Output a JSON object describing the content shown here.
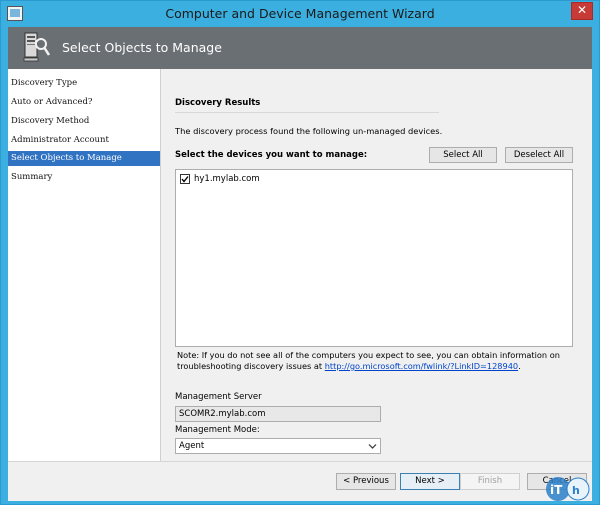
{
  "window": {
    "title": "Computer and Device Management Wizard",
    "close_label": "✕"
  },
  "header": {
    "title": "Select Objects to Manage"
  },
  "nav": {
    "items": [
      {
        "label": "Discovery Type"
      },
      {
        "label": "Auto or Advanced?"
      },
      {
        "label": "Discovery Method"
      },
      {
        "label": "Administrator Account"
      },
      {
        "label": "Select Objects to Manage",
        "active": true
      },
      {
        "label": "Summary"
      }
    ]
  },
  "main": {
    "section_title": "Discovery Results",
    "intro": "The discovery process found the following un-managed devices.",
    "select_label": "Select the devices you want to manage:",
    "select_all_label": "Select All",
    "deselect_all_label": "Deselect All",
    "devices": [
      {
        "name": "hy1.mylab.com",
        "checked": true
      }
    ],
    "note_text": "Note: If you do not see all of the computers you expect to see, you can obtain information on troubleshooting discovery issues at ",
    "note_link": "http://go.microsoft.com/fwlink/?LinkID=128940",
    "note_end": ".",
    "management_server_label": "Management Server",
    "management_server_value": "SCOMR2.mylab.com",
    "management_mode_label": "Management Mode:",
    "management_mode_value": "Agent"
  },
  "footer": {
    "previous_label": "< Previous",
    "next_label": "Next >",
    "finish_label": "Finish",
    "cancel_label": "Cancel"
  },
  "watermark": {
    "text": "iThome"
  },
  "colors": {
    "titlebar": "#3bb0e0",
    "header": "#6a6f73",
    "nav_active": "#3173c3",
    "close_button": "#c73a35",
    "link": "#0044cc"
  }
}
